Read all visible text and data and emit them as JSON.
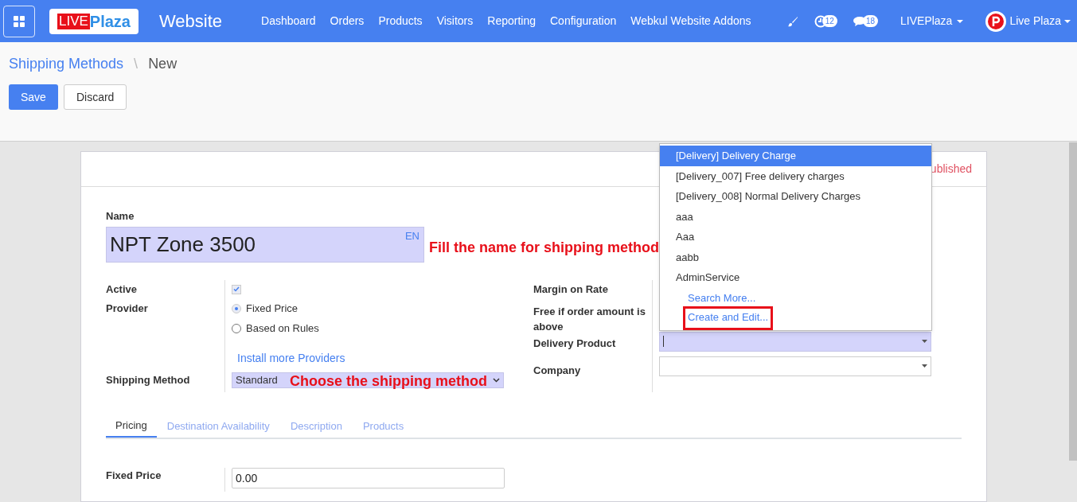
{
  "navbar": {
    "logo": {
      "part_1": "LIVE",
      "part_2": "Plaza"
    },
    "app_name": "Website",
    "menu": [
      "Dashboard",
      "Orders",
      "Products",
      "Visitors",
      "Reporting",
      "Configuration",
      "Webkul Website Addons"
    ],
    "activity_count": "12",
    "message_count": "18",
    "company": "LIVEPlaza",
    "user": "Live Plaza"
  },
  "breadcrumb": {
    "parent": "Shipping Methods",
    "separator": "\\",
    "current": "New"
  },
  "buttons": [
    "Save",
    "Discard"
  ],
  "sheet": {
    "status": "ublished",
    "name_label": "Name",
    "name_value": "NPT Zone 3500",
    "language": "EN",
    "left_fields": [
      {
        "kind": "checkbox",
        "label": "Active",
        "checked": true
      },
      {
        "kind": "radio",
        "label": "Provider",
        "options": [
          {
            "label": "Fixed Price",
            "selected": true
          },
          {
            "label": "Based on Rules",
            "selected": false
          }
        ],
        "link": "Install more Providers"
      },
      {
        "kind": "select",
        "label": "Shipping Method",
        "value": "Standard"
      }
    ],
    "right_fields": [
      {
        "label": "Margin on Rate"
      },
      {
        "label": "Free if order amount is above"
      },
      {
        "label": "Delivery Product",
        "focused": true
      },
      {
        "label": "Company",
        "focused": false
      }
    ],
    "tabs": [
      {
        "label": "Pricing",
        "selected": true
      },
      {
        "label": "Destination Availability",
        "selected": false
      },
      {
        "label": "Description",
        "selected": false
      },
      {
        "label": "Products",
        "selected": false
      }
    ],
    "fixed_price": {
      "label": "Fixed Price",
      "value": "0.00"
    }
  },
  "dropdown": {
    "items": [
      {
        "label": "[Delivery] Delivery Charge",
        "selected": true
      },
      {
        "label": "[Delivery_007] Free delivery charges",
        "selected": false
      },
      {
        "label": "[Delivery_008] Normal Delivery Charges",
        "selected": false
      },
      {
        "label": "aaa",
        "selected": false
      },
      {
        "label": "Aaa",
        "selected": false
      },
      {
        "label": "aabb",
        "selected": false
      },
      {
        "label": "AdminService",
        "selected": false
      }
    ],
    "actions": [
      {
        "label": "Search More...",
        "highlighted": false
      },
      {
        "label": "Create and Edit...",
        "highlighted": true
      }
    ]
  },
  "annotations": {
    "name_hint": "Fill the name for shipping method",
    "method_hint": "Choose the shipping method"
  }
}
